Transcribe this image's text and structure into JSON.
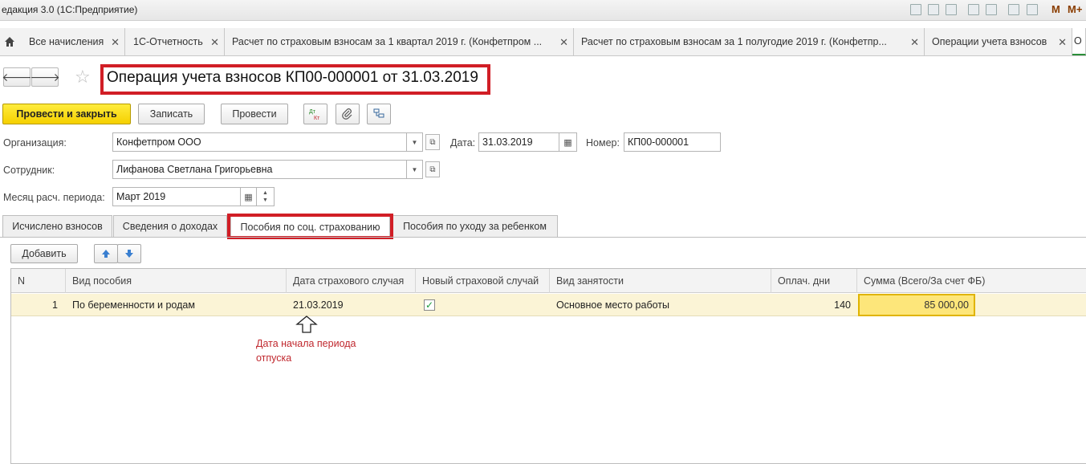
{
  "window": {
    "title": "едакция 3.0  (1С:Предприятие)",
    "right_letters": [
      "M",
      "M+"
    ]
  },
  "tabs": [
    {
      "label": "Все начисления"
    },
    {
      "label": "1С-Отчетность"
    },
    {
      "label": "Расчет по страховым взносам за 1 квартал 2019 г. (Конфетпром ..."
    },
    {
      "label": "Расчет по страховым взносам за 1 полугодие 2019 г. (Конфетпр..."
    },
    {
      "label": "Операции учета взносов"
    },
    {
      "label": "О"
    }
  ],
  "document": {
    "title": "Операция учета взносов КП00-000001 от 31.03.2019"
  },
  "toolbar": {
    "post_close": "Провести и закрыть",
    "save": "Записать",
    "post": "Провести",
    "dtkt_icon": "Дт Кт"
  },
  "fields": {
    "org_label": "Организация:",
    "org_value": "Конфетпром ООО",
    "date_label": "Дата:",
    "date_value": "31.03.2019",
    "number_label": "Номер:",
    "number_value": "КП00-000001",
    "employee_label": "Сотрудник:",
    "employee_value": "Лифанова Светлана Григорьевна",
    "month_label": "Месяц расч. периода:",
    "month_value": "Март 2019"
  },
  "inner_tabs": [
    {
      "label": "Исчислено взносов"
    },
    {
      "label": "Сведения о доходах"
    },
    {
      "label": "Пособия по соц. страхованию"
    },
    {
      "label": "Пособия по уходу за ребенком"
    }
  ],
  "table_toolbar": {
    "add": "Добавить"
  },
  "table": {
    "columns": [
      "N",
      "Вид пособия",
      "Дата страхового случая",
      "Новый страховой случай",
      "Вид занятости",
      "Оплач. дни",
      "Сумма (Всего/За счет ФБ)"
    ],
    "rows": [
      {
        "n": "1",
        "kind": "По беременности и родам",
        "date": "21.03.2019",
        "new_case": true,
        "employment": "Основное место работы",
        "days": "140",
        "sum": "85 000,00"
      }
    ]
  },
  "annotation": {
    "line1": "Дата начала периода",
    "line2": "отпуска"
  },
  "colors": {
    "accent_red": "#d11e26",
    "primary_yellow": "#f5d000",
    "row_highlight": "#fbf4d6"
  }
}
